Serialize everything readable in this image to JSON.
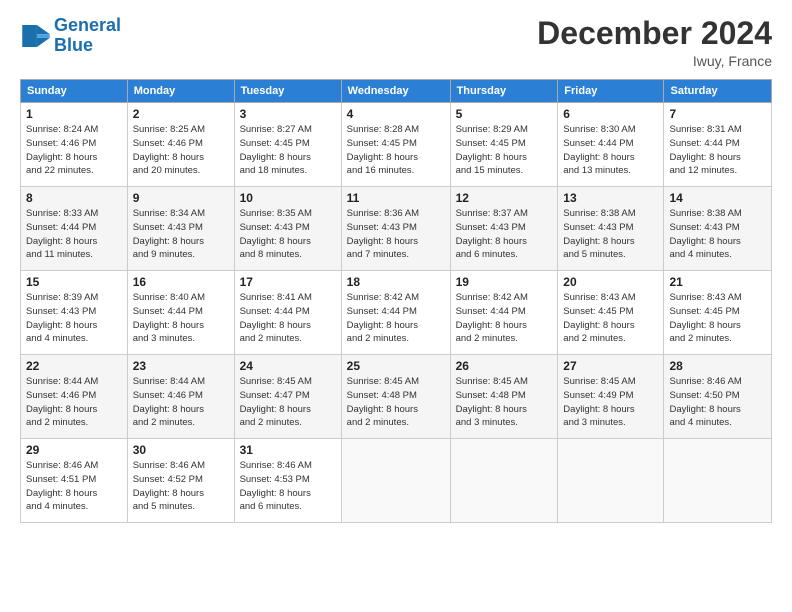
{
  "header": {
    "logo_line1": "General",
    "logo_line2": "Blue",
    "month": "December 2024",
    "location": "Iwuy, France"
  },
  "days_of_week": [
    "Sunday",
    "Monday",
    "Tuesday",
    "Wednesday",
    "Thursday",
    "Friday",
    "Saturday"
  ],
  "weeks": [
    [
      {
        "day": "1",
        "info": "Sunrise: 8:24 AM\nSunset: 4:46 PM\nDaylight: 8 hours\nand 22 minutes."
      },
      {
        "day": "2",
        "info": "Sunrise: 8:25 AM\nSunset: 4:46 PM\nDaylight: 8 hours\nand 20 minutes."
      },
      {
        "day": "3",
        "info": "Sunrise: 8:27 AM\nSunset: 4:45 PM\nDaylight: 8 hours\nand 18 minutes."
      },
      {
        "day": "4",
        "info": "Sunrise: 8:28 AM\nSunset: 4:45 PM\nDaylight: 8 hours\nand 16 minutes."
      },
      {
        "day": "5",
        "info": "Sunrise: 8:29 AM\nSunset: 4:45 PM\nDaylight: 8 hours\nand 15 minutes."
      },
      {
        "day": "6",
        "info": "Sunrise: 8:30 AM\nSunset: 4:44 PM\nDaylight: 8 hours\nand 13 minutes."
      },
      {
        "day": "7",
        "info": "Sunrise: 8:31 AM\nSunset: 4:44 PM\nDaylight: 8 hours\nand 12 minutes."
      }
    ],
    [
      {
        "day": "8",
        "info": "Sunrise: 8:33 AM\nSunset: 4:44 PM\nDaylight: 8 hours\nand 11 minutes."
      },
      {
        "day": "9",
        "info": "Sunrise: 8:34 AM\nSunset: 4:43 PM\nDaylight: 8 hours\nand 9 minutes."
      },
      {
        "day": "10",
        "info": "Sunrise: 8:35 AM\nSunset: 4:43 PM\nDaylight: 8 hours\nand 8 minutes."
      },
      {
        "day": "11",
        "info": "Sunrise: 8:36 AM\nSunset: 4:43 PM\nDaylight: 8 hours\nand 7 minutes."
      },
      {
        "day": "12",
        "info": "Sunrise: 8:37 AM\nSunset: 4:43 PM\nDaylight: 8 hours\nand 6 minutes."
      },
      {
        "day": "13",
        "info": "Sunrise: 8:38 AM\nSunset: 4:43 PM\nDaylight: 8 hours\nand 5 minutes."
      },
      {
        "day": "14",
        "info": "Sunrise: 8:38 AM\nSunset: 4:43 PM\nDaylight: 8 hours\nand 4 minutes."
      }
    ],
    [
      {
        "day": "15",
        "info": "Sunrise: 8:39 AM\nSunset: 4:43 PM\nDaylight: 8 hours\nand 4 minutes."
      },
      {
        "day": "16",
        "info": "Sunrise: 8:40 AM\nSunset: 4:44 PM\nDaylight: 8 hours\nand 3 minutes."
      },
      {
        "day": "17",
        "info": "Sunrise: 8:41 AM\nSunset: 4:44 PM\nDaylight: 8 hours\nand 2 minutes."
      },
      {
        "day": "18",
        "info": "Sunrise: 8:42 AM\nSunset: 4:44 PM\nDaylight: 8 hours\nand 2 minutes."
      },
      {
        "day": "19",
        "info": "Sunrise: 8:42 AM\nSunset: 4:44 PM\nDaylight: 8 hours\nand 2 minutes."
      },
      {
        "day": "20",
        "info": "Sunrise: 8:43 AM\nSunset: 4:45 PM\nDaylight: 8 hours\nand 2 minutes."
      },
      {
        "day": "21",
        "info": "Sunrise: 8:43 AM\nSunset: 4:45 PM\nDaylight: 8 hours\nand 2 minutes."
      }
    ],
    [
      {
        "day": "22",
        "info": "Sunrise: 8:44 AM\nSunset: 4:46 PM\nDaylight: 8 hours\nand 2 minutes."
      },
      {
        "day": "23",
        "info": "Sunrise: 8:44 AM\nSunset: 4:46 PM\nDaylight: 8 hours\nand 2 minutes."
      },
      {
        "day": "24",
        "info": "Sunrise: 8:45 AM\nSunset: 4:47 PM\nDaylight: 8 hours\nand 2 minutes."
      },
      {
        "day": "25",
        "info": "Sunrise: 8:45 AM\nSunset: 4:48 PM\nDaylight: 8 hours\nand 2 minutes."
      },
      {
        "day": "26",
        "info": "Sunrise: 8:45 AM\nSunset: 4:48 PM\nDaylight: 8 hours\nand 3 minutes."
      },
      {
        "day": "27",
        "info": "Sunrise: 8:45 AM\nSunset: 4:49 PM\nDaylight: 8 hours\nand 3 minutes."
      },
      {
        "day": "28",
        "info": "Sunrise: 8:46 AM\nSunset: 4:50 PM\nDaylight: 8 hours\nand 4 minutes."
      }
    ],
    [
      {
        "day": "29",
        "info": "Sunrise: 8:46 AM\nSunset: 4:51 PM\nDaylight: 8 hours\nand 4 minutes."
      },
      {
        "day": "30",
        "info": "Sunrise: 8:46 AM\nSunset: 4:52 PM\nDaylight: 8 hours\nand 5 minutes."
      },
      {
        "day": "31",
        "info": "Sunrise: 8:46 AM\nSunset: 4:53 PM\nDaylight: 8 hours\nand 6 minutes."
      },
      {
        "day": "",
        "info": ""
      },
      {
        "day": "",
        "info": ""
      },
      {
        "day": "",
        "info": ""
      },
      {
        "day": "",
        "info": ""
      }
    ]
  ]
}
